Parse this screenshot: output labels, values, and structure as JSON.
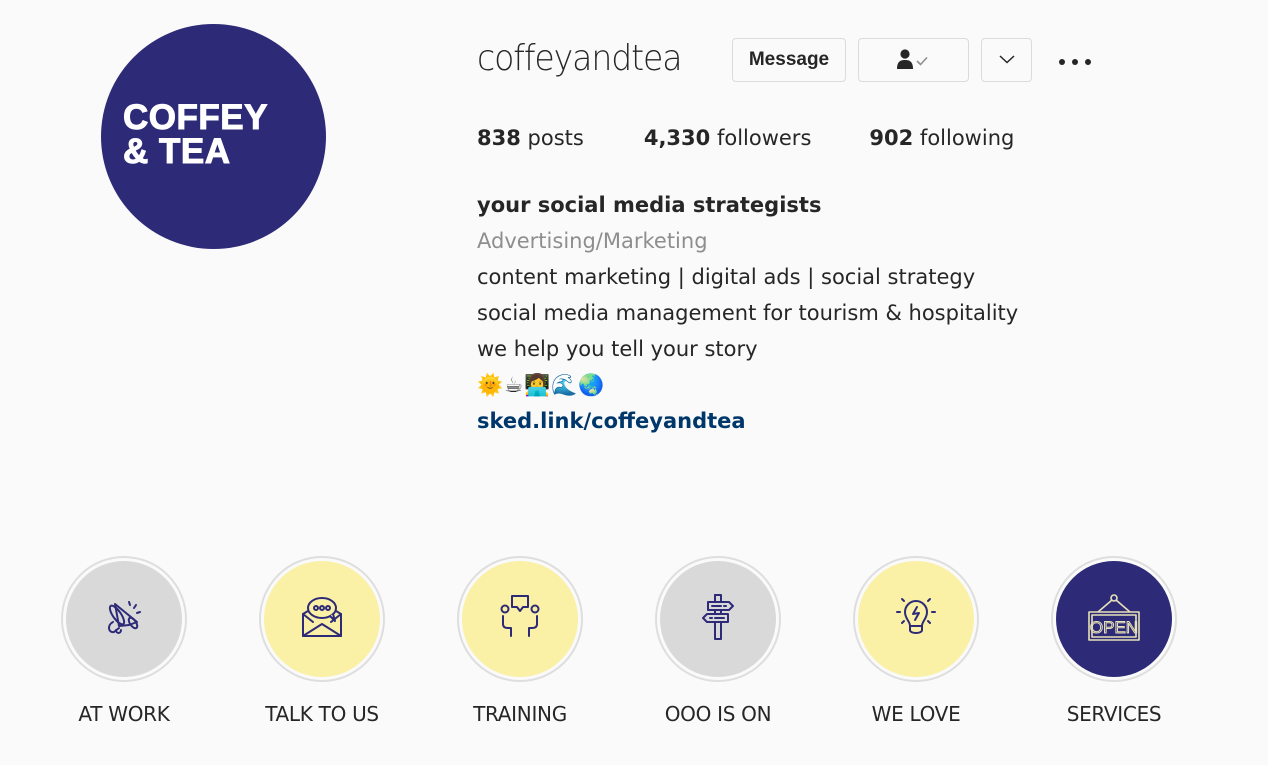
{
  "profile": {
    "avatar_text_line1": "COFFEY",
    "avatar_text_line2": "& TEA",
    "avatar_color": "#2d2a78",
    "username": "coffeyandtea"
  },
  "actions": {
    "message_label": "Message",
    "following_icon": "person-check-icon",
    "dropdown_icon": "chevron-down-icon",
    "more_icon": "more-options-icon"
  },
  "stats": {
    "posts_count": "838",
    "posts_label": "posts",
    "followers_count": "4,330",
    "followers_label": "followers",
    "following_count": "902",
    "following_label": "following"
  },
  "bio": {
    "name": "your social media strategists",
    "category": "Advertising/Marketing",
    "lines": [
      "content marketing | digital ads | social strategy",
      "social media management for tourism & hospitality",
      "we help you tell your story"
    ],
    "emoji": "🌞☕👩‍💻🌊🌏",
    "link": "sked.link/coffeyandtea"
  },
  "highlights": [
    {
      "label": "AT WORK",
      "icon": "megaphone-icon",
      "bg": "#d9d9d9"
    },
    {
      "label": "TALK TO US",
      "icon": "envelope-chat-icon",
      "bg": "#faf0a6"
    },
    {
      "label": "TRAINING",
      "icon": "people-talking-icon",
      "bg": "#faf0a6"
    },
    {
      "label": "OOO IS ON",
      "icon": "signpost-icon",
      "bg": "#d9d9d9"
    },
    {
      "label": "WE LOVE",
      "icon": "lightbulb-icon",
      "bg": "#faf0a6"
    },
    {
      "label": "SERVICES",
      "icon": "open-sign-icon",
      "bg": "#2d2a78",
      "sign_text": "OPEN"
    }
  ],
  "colors": {
    "icon_stroke": "#2d2a78",
    "link": "#00376b",
    "muted": "#8e8e8e"
  }
}
